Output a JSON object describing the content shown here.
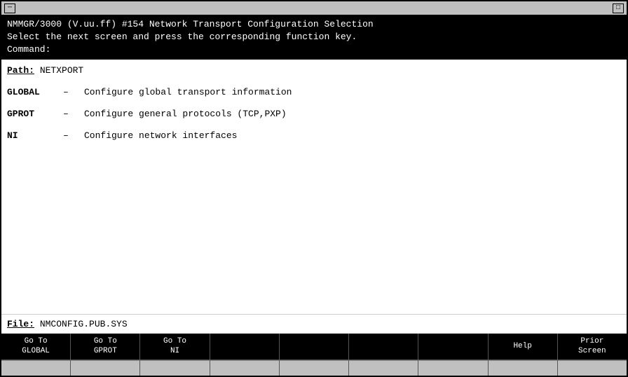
{
  "window": {
    "title": "",
    "minimize_label": "_",
    "maximize_label": "□"
  },
  "header": {
    "line1": "NMMGR/3000 (V.uu.ff) #154  Network Transport Configuration Selection",
    "line2": "Select the next screen and press the corresponding function key.",
    "line3": "Command:"
  },
  "path": {
    "label": "Path:",
    "value": "NETXPORT"
  },
  "menu_items": [
    {
      "key": "GLOBAL",
      "dash": "—",
      "description": "Configure global transport information"
    },
    {
      "key": "GPROT",
      "dash": "—",
      "description": "Configure general protocols (TCP,PXP)"
    },
    {
      "key": "NI",
      "dash": "—",
      "description": "Configure network interfaces"
    }
  ],
  "file": {
    "label": "File:",
    "value": "NMCONFIG.PUB.SYS"
  },
  "function_keys": [
    {
      "label": "Go To\nGLOBAL",
      "active": true
    },
    {
      "label": "Go To\nGPROT",
      "active": true
    },
    {
      "label": "Go To\nNI",
      "active": true
    },
    {
      "label": "",
      "active": false
    },
    {
      "label": "",
      "active": false
    },
    {
      "label": "",
      "active": false
    },
    {
      "label": "",
      "active": false
    },
    {
      "label": "Help",
      "active": true
    },
    {
      "label": "Prior\nScreen",
      "active": true
    }
  ]
}
